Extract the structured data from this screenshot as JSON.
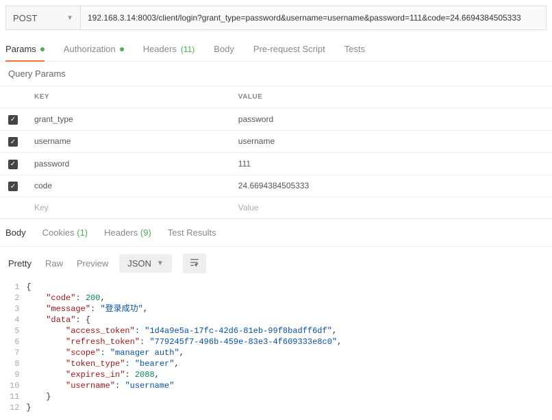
{
  "request": {
    "method": "POST",
    "url": "192.168.3.14:8003/client/login?grant_type=password&username=username&password=111&code=24.6694384505333"
  },
  "tabs": {
    "params": "Params",
    "authorization": "Authorization",
    "headers": "Headers",
    "headers_count": "(11)",
    "body": "Body",
    "prerequest": "Pre-request Script",
    "tests": "Tests"
  },
  "section_title": "Query Params",
  "table": {
    "key_header": "KEY",
    "value_header": "VALUE",
    "rows": [
      {
        "key": "grant_type",
        "value": "password"
      },
      {
        "key": "username",
        "value": "username"
      },
      {
        "key": "password",
        "value": "111"
      },
      {
        "key": "code",
        "value": "24.6694384505333"
      }
    ],
    "new_key": "Key",
    "new_value": "Value"
  },
  "response_tabs": {
    "body": "Body",
    "cookies": "Cookies",
    "cookies_count": "(1)",
    "headers": "Headers",
    "headers_count": "(9)",
    "tests": "Test Results"
  },
  "view": {
    "pretty": "Pretty",
    "raw": "Raw",
    "preview": "Preview",
    "format": "JSON"
  },
  "json_lines": [
    [
      {
        "t": "brace",
        "v": "{"
      }
    ],
    [
      {
        "t": "sp",
        "v": "    "
      },
      {
        "t": "key",
        "v": "\"code\""
      },
      {
        "t": "brace",
        "v": ": "
      },
      {
        "t": "num",
        "v": "200"
      },
      {
        "t": "brace",
        "v": ","
      }
    ],
    [
      {
        "t": "sp",
        "v": "    "
      },
      {
        "t": "key",
        "v": "\"message\""
      },
      {
        "t": "brace",
        "v": ": "
      },
      {
        "t": "str",
        "v": "\"登录成功\""
      },
      {
        "t": "brace",
        "v": ","
      }
    ],
    [
      {
        "t": "sp",
        "v": "    "
      },
      {
        "t": "key",
        "v": "\"data\""
      },
      {
        "t": "brace",
        "v": ": {"
      }
    ],
    [
      {
        "t": "sp",
        "v": "        "
      },
      {
        "t": "key",
        "v": "\"access_token\""
      },
      {
        "t": "brace",
        "v": ": "
      },
      {
        "t": "str",
        "v": "\"1d4a9e5a-17fc-42d6-81eb-99f8badff6df\""
      },
      {
        "t": "brace",
        "v": ","
      }
    ],
    [
      {
        "t": "sp",
        "v": "        "
      },
      {
        "t": "key",
        "v": "\"refresh_token\""
      },
      {
        "t": "brace",
        "v": ": "
      },
      {
        "t": "str",
        "v": "\"779245f7-496b-459e-83e3-4f609333e8c0\""
      },
      {
        "t": "brace",
        "v": ","
      }
    ],
    [
      {
        "t": "sp",
        "v": "        "
      },
      {
        "t": "key",
        "v": "\"scope\""
      },
      {
        "t": "brace",
        "v": ": "
      },
      {
        "t": "str",
        "v": "\"manager auth\""
      },
      {
        "t": "brace",
        "v": ","
      }
    ],
    [
      {
        "t": "sp",
        "v": "        "
      },
      {
        "t": "key",
        "v": "\"token_type\""
      },
      {
        "t": "brace",
        "v": ": "
      },
      {
        "t": "str",
        "v": "\"bearer\""
      },
      {
        "t": "brace",
        "v": ","
      }
    ],
    [
      {
        "t": "sp",
        "v": "        "
      },
      {
        "t": "key",
        "v": "\"expires_in\""
      },
      {
        "t": "brace",
        "v": ": "
      },
      {
        "t": "num",
        "v": "2088"
      },
      {
        "t": "brace",
        "v": ","
      }
    ],
    [
      {
        "t": "sp",
        "v": "        "
      },
      {
        "t": "key",
        "v": "\"username\""
      },
      {
        "t": "brace",
        "v": ": "
      },
      {
        "t": "str",
        "v": "\"username\""
      }
    ],
    [
      {
        "t": "sp",
        "v": "    "
      },
      {
        "t": "brace",
        "v": "}"
      }
    ],
    [
      {
        "t": "brace",
        "v": "}"
      }
    ]
  ]
}
